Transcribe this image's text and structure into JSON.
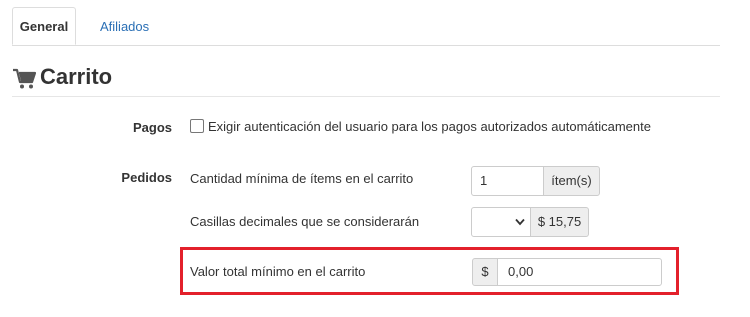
{
  "tabs": [
    {
      "label": "General",
      "active": true
    },
    {
      "label": "Afiliados",
      "active": false
    }
  ],
  "section": {
    "title": "Carrito",
    "icon": "cart-icon"
  },
  "pagos": {
    "label": "Pagos",
    "checkbox_label": "Exigir autenticación del usuario para los pagos autorizados automáticamente",
    "checked": false
  },
  "pedidos": {
    "label": "Pedidos",
    "min_items": {
      "label": "Cantidad mínima de ítems en el carrito",
      "value": "1",
      "unit": "ítem(s)"
    },
    "decimals": {
      "label": "Casillas decimales que se considerarán",
      "value": "",
      "preview": "$ 15,75"
    },
    "min_total": {
      "label": "Valor total mínimo en el carrito",
      "currency": "$",
      "value": "0,00"
    }
  },
  "colors": {
    "accent": "#2a6fb5",
    "highlight": "#e3202b"
  }
}
